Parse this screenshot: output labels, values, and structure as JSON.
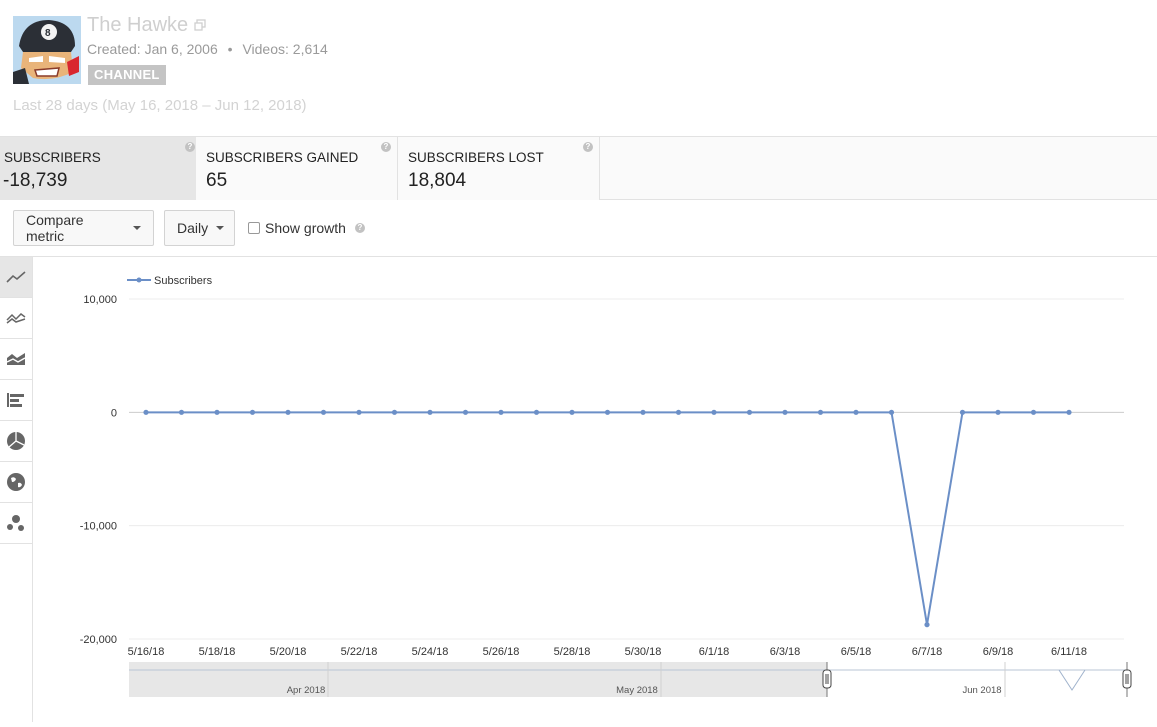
{
  "channel": {
    "name": "The Hawke",
    "created_label": "Created: Jan 6, 2006",
    "videos_label": "Videos: 2,614",
    "badge": "CHANNEL",
    "date_range": "Last 28 days (May 16, 2018 – Jun 12, 2018)"
  },
  "metrics": [
    {
      "label": "SUBSCRIBERS",
      "value": "-18,739"
    },
    {
      "label": "SUBSCRIBERS GAINED",
      "value": "65"
    },
    {
      "label": "SUBSCRIBERS LOST",
      "value": "18,804"
    }
  ],
  "controls": {
    "compare_label": "Compare metric",
    "interval_label": "Daily",
    "growth_label": "Show growth"
  },
  "toolbar": [
    "line-chart-icon",
    "multi-line-chart-icon",
    "stacked-area-icon",
    "bar-chart-icon",
    "pie-chart-icon",
    "globe-map-icon",
    "bubble-chart-icon"
  ],
  "chart_data": {
    "type": "line",
    "legend": "Subscribers",
    "legend_position": "top-left",
    "series": [
      {
        "name": "Subscribers",
        "color": "#6b8fc7",
        "values": [
          0,
          0,
          0,
          0,
          0,
          0,
          0,
          0,
          0,
          0,
          0,
          0,
          0,
          0,
          0,
          0,
          0,
          0,
          0,
          0,
          0,
          0,
          -18739,
          0,
          0,
          0,
          0
        ]
      }
    ],
    "x_tick_labels": [
      "5/16/18",
      "5/18/18",
      "5/20/18",
      "5/22/18",
      "5/24/18",
      "5/26/18",
      "5/28/18",
      "5/30/18",
      "6/1/18",
      "6/3/18",
      "6/5/18",
      "6/7/18",
      "6/9/18",
      "6/11/18"
    ],
    "y_ticks": [
      10000,
      0,
      -10000,
      -20000
    ],
    "y_tick_labels": [
      "10,000",
      "0",
      "-10,000",
      "-20,000"
    ],
    "ylim": [
      -20000,
      10000
    ],
    "grid": true,
    "navigator_labels": [
      "Apr 2018",
      "May 2018",
      "Jun 2018"
    ]
  }
}
